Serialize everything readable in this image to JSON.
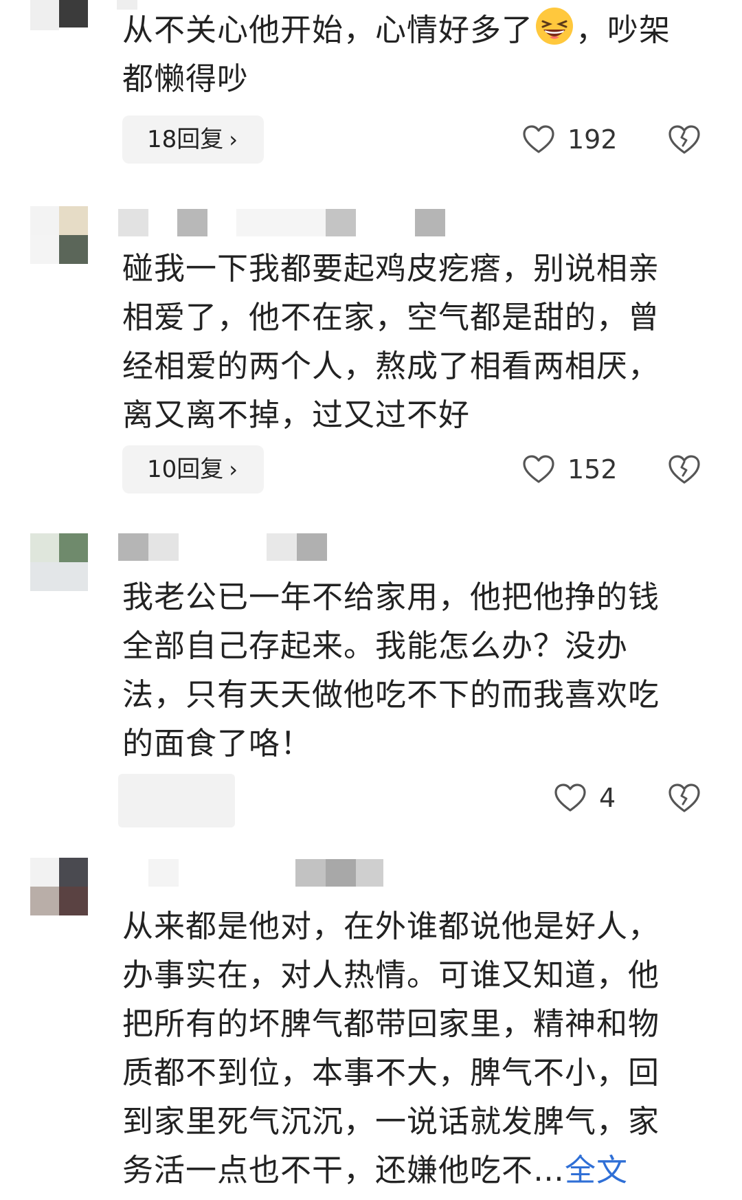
{
  "comments": [
    {
      "text_before_emoji": "从不关心他开始，心情好多了",
      "emoji": "grinning-squinting-face-emoji",
      "text_after_emoji": "，吵架\n都懒得吵",
      "reply_label": "18回复",
      "likes": "192"
    },
    {
      "text": "碰我一下我都要起鸡皮疙瘩，别说相亲\n相爱了，他不在家，空气都是甜的，曾\n经相爱的两个人，熬成了相看两相厌，\n离又离不掉，过又过不好",
      "reply_label": "10回复",
      "likes": "152"
    },
    {
      "text": "我老公已一年不给家用，他把他挣的钱\n全部自己存起来。我能怎么办？没办\n法，只有天天做他吃不下的而我喜欢吃\n的面食了咯！",
      "likes": "4"
    },
    {
      "text": "从来都是他对，在外谁都说他是好人，\n办事实在，对人热情。可谁又知道，他\n把所有的坏脾气都带回家里，精神和物\n质都不到位，本事不大，脾气不小，回\n到家里死气沉沉，一说话就发脾气，家\n务活一点也不干，还嫌他吃不…",
      "more_label": "全文"
    }
  ],
  "icons": {
    "like": "heart-outline-icon",
    "dislike": "broken-heart-icon",
    "reply_chevron": "chevron-right-icon"
  },
  "colors": {
    "link": "#2f6fd6",
    "text": "#222222",
    "reply_bg": "#f3f3f3",
    "icon": "#555555"
  }
}
